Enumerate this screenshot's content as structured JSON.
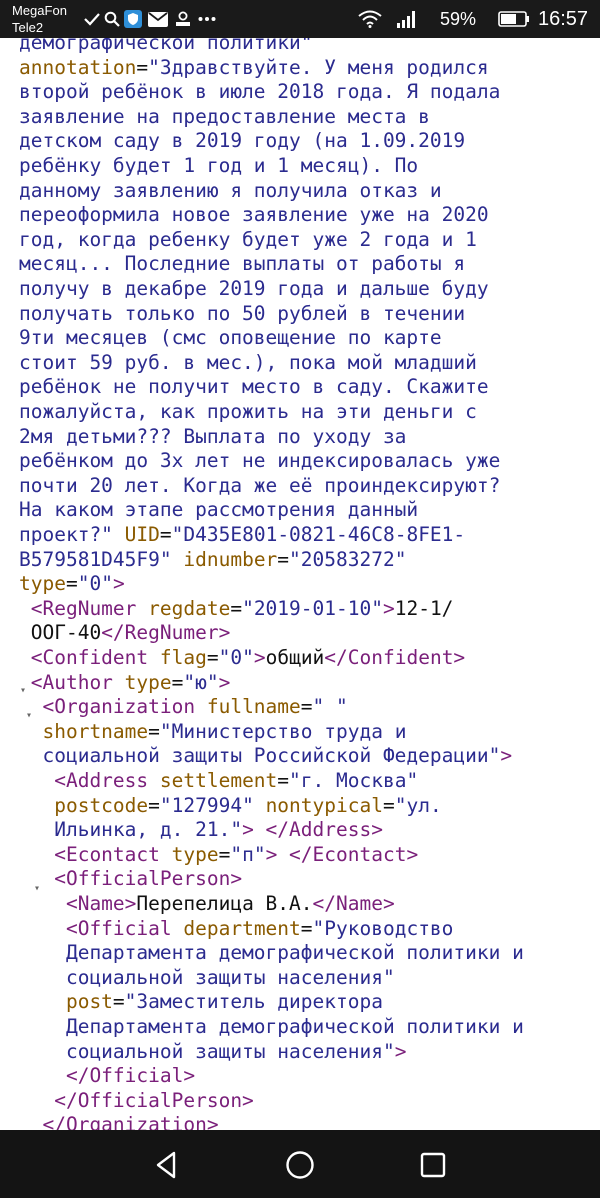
{
  "status_bar": {
    "carrier_primary": "MegaFon",
    "carrier_secondary": "Tele2",
    "battery_percent": "59%",
    "time": "16:57",
    "icons": [
      "check-icon",
      "search-icon",
      "shield-icon",
      "mail-icon",
      "sim-icon",
      "more-icon",
      "wifi-icon",
      "signal-icon",
      "battery-icon"
    ]
  },
  "document": {
    "lines": [
      [
        [
          "val",
          "демографической политики\""
        ]
      ],
      [
        [
          "attr",
          "annotation"
        ],
        [
          "txt",
          "="
        ],
        [
          "val",
          "\"Здравствуйте. У меня родился"
        ]
      ],
      [
        [
          "val",
          "второй ребёнок в июле 2018 года. Я подала"
        ]
      ],
      [
        [
          "val",
          "заявление на предоставление места в"
        ]
      ],
      [
        [
          "val",
          "детском саду в 2019 году (на 1.09.2019"
        ]
      ],
      [
        [
          "val",
          "ребёнку будет 1 год и 1 месяц). По"
        ]
      ],
      [
        [
          "val",
          "данному заявлению я получила отказ и"
        ]
      ],
      [
        [
          "val",
          "переоформила новое заявление уже на 2020"
        ]
      ],
      [
        [
          "val",
          "год, когда ребенку будет уже 2 года и 1"
        ]
      ],
      [
        [
          "val",
          "месяц... Последние выплаты от работы я"
        ]
      ],
      [
        [
          "val",
          "получу в декабре 2019 года и дальше буду"
        ]
      ],
      [
        [
          "val",
          "получать только по 50 рублей в течении"
        ]
      ],
      [
        [
          "val",
          "9ти месяцев (смс оповещение по карте"
        ]
      ],
      [
        [
          "val",
          "стоит 59 руб. в мес.), пока мой младший"
        ]
      ],
      [
        [
          "val",
          "ребёнок не получит место в саду. Скажите"
        ]
      ],
      [
        [
          "val",
          "пожалуйста, как прожить на эти деньги с"
        ]
      ],
      [
        [
          "val",
          "2мя детьми??? Выплата по уходу за"
        ]
      ],
      [
        [
          "val",
          "ребёнком до 3х лет не индексировалась уже"
        ]
      ],
      [
        [
          "val",
          "почти 20 лет. Когда же её проиндексируют?"
        ]
      ],
      [
        [
          "val",
          "На каком этапе рассмотрения данный"
        ]
      ],
      [
        [
          "val",
          "проект?\" "
        ],
        [
          "attr",
          "UID"
        ],
        [
          "txt",
          "="
        ],
        [
          "val",
          "\"D435E801-0821-46C8-8FE1-"
        ]
      ],
      [
        [
          "val",
          "B579581D45F9\" "
        ],
        [
          "attr",
          "idnumber"
        ],
        [
          "txt",
          "="
        ],
        [
          "val",
          "\"20583272\""
        ]
      ],
      [
        [
          "attr",
          "type"
        ],
        [
          "txt",
          "="
        ],
        [
          "val",
          "\"0\""
        ],
        [
          "tag",
          ">"
        ]
      ],
      [
        [
          "tag",
          " <RegNumer "
        ],
        [
          "attr",
          "regdate"
        ],
        [
          "txt",
          "="
        ],
        [
          "val",
          "\"2019-01-10\""
        ],
        [
          "tag",
          ">"
        ],
        [
          "txt",
          "12-1/"
        ]
      ],
      [
        [
          "txt",
          " ООГ-40"
        ],
        [
          "tag",
          "</RegNumer>"
        ]
      ],
      [
        [
          "tag",
          " <Confident "
        ],
        [
          "attr",
          "flag"
        ],
        [
          "txt",
          "="
        ],
        [
          "val",
          "\"0\""
        ],
        [
          "tag",
          ">"
        ],
        [
          "txt",
          "общий"
        ],
        [
          "tag",
          "</Confident>"
        ]
      ],
      [
        [
          "tag",
          " <Author "
        ],
        [
          "attr",
          "type"
        ],
        [
          "txt",
          "="
        ],
        [
          "val",
          "\"ю\""
        ],
        [
          "tag",
          ">"
        ]
      ],
      [
        [
          "tag",
          "  <Organization "
        ],
        [
          "attr",
          "fullname"
        ],
        [
          "txt",
          "="
        ],
        [
          "val",
          "\" \""
        ]
      ],
      [
        [
          "attr",
          "  shortname"
        ],
        [
          "txt",
          "="
        ],
        [
          "val",
          "\"Министерство труда и"
        ]
      ],
      [
        [
          "val",
          "  социальной защиты Российской Федерации\""
        ],
        [
          "tag",
          ">"
        ]
      ],
      [
        [
          "tag",
          "   <Address "
        ],
        [
          "attr",
          "settlement"
        ],
        [
          "txt",
          "="
        ],
        [
          "val",
          "\"г. Москва\""
        ]
      ],
      [
        [
          "attr",
          "   postcode"
        ],
        [
          "txt",
          "="
        ],
        [
          "val",
          "\"127994\" "
        ],
        [
          "attr",
          "nontypical"
        ],
        [
          "txt",
          "="
        ],
        [
          "val",
          "\"ул."
        ]
      ],
      [
        [
          "val",
          "   Ильинка, д. 21.\""
        ],
        [
          "tag",
          "> </Address>"
        ]
      ],
      [
        [
          "tag",
          "   <Econtact "
        ],
        [
          "attr",
          "type"
        ],
        [
          "txt",
          "="
        ],
        [
          "val",
          "\"п\""
        ],
        [
          "tag",
          "> </Econtact>"
        ]
      ],
      [
        [
          "tag",
          "   <OfficialPerson>"
        ]
      ],
      [
        [
          "tag",
          "    <Name>"
        ],
        [
          "txt",
          "Перепелица В.А."
        ],
        [
          "tag",
          "</Name>"
        ]
      ],
      [
        [
          "tag",
          "    <Official "
        ],
        [
          "attr",
          "department"
        ],
        [
          "txt",
          "="
        ],
        [
          "val",
          "\"Руководство"
        ]
      ],
      [
        [
          "val",
          "    Департамента демографической политики и"
        ]
      ],
      [
        [
          "val",
          "    социальной защиты населения\""
        ]
      ],
      [
        [
          "attr",
          "    post"
        ],
        [
          "txt",
          "="
        ],
        [
          "val",
          "\"Заместитель директора"
        ]
      ],
      [
        [
          "val",
          "    Департамента демографической политики и"
        ]
      ],
      [
        [
          "val",
          "    социальной защиты населения\""
        ],
        [
          "tag",
          ">"
        ]
      ],
      [
        [
          "tag",
          "    </Official>"
        ]
      ],
      [
        [
          "tag",
          "   </OfficialPerson>"
        ]
      ],
      [
        [
          "tag",
          "  </Organization>"
        ]
      ]
    ]
  }
}
